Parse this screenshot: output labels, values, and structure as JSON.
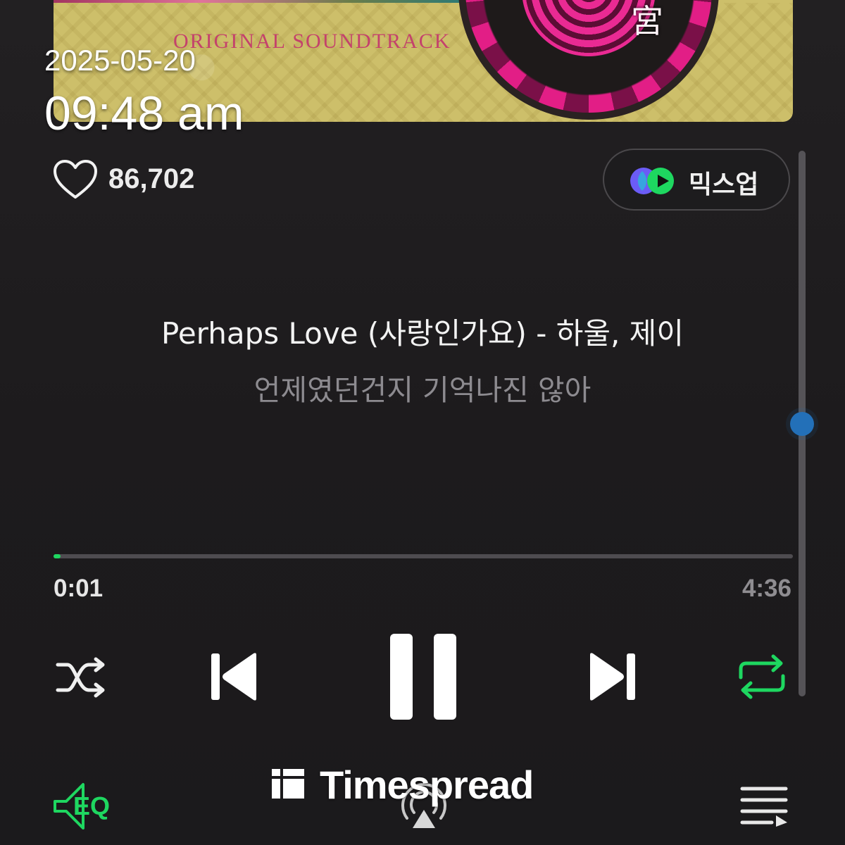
{
  "album": {
    "caption": "ORIGINAL  SOUNDTRACK",
    "hanja": "宮"
  },
  "timestamp": {
    "date": "2025-05-20",
    "time": "09:48 am"
  },
  "like": {
    "icon": "heart-icon",
    "count": "86,702"
  },
  "mixup": {
    "label": "믹스업",
    "icon": "mixup-logo-icon"
  },
  "track": {
    "title": "Perhaps Love (사랑인가요) - 하울, 제이",
    "lyric": "언제였던건지 기억나진 않아"
  },
  "progress": {
    "elapsed": "0:01",
    "total": "4:36",
    "fraction": 0.004
  },
  "controls": {
    "shuffle": "shuffle-icon",
    "previous": "skip-previous-icon",
    "play_state": "pause-icon",
    "next": "skip-next-icon",
    "repeat": "repeat-icon"
  },
  "bottom_bar": {
    "eq_label": "EQ",
    "cast": "cast-icon",
    "queue": "queue-icon"
  },
  "watermark": {
    "text": "Timespread"
  },
  "colors": {
    "accent_green": "#1ed760",
    "scroll_thumb": "#2370b8",
    "background": "#1f1d20"
  }
}
